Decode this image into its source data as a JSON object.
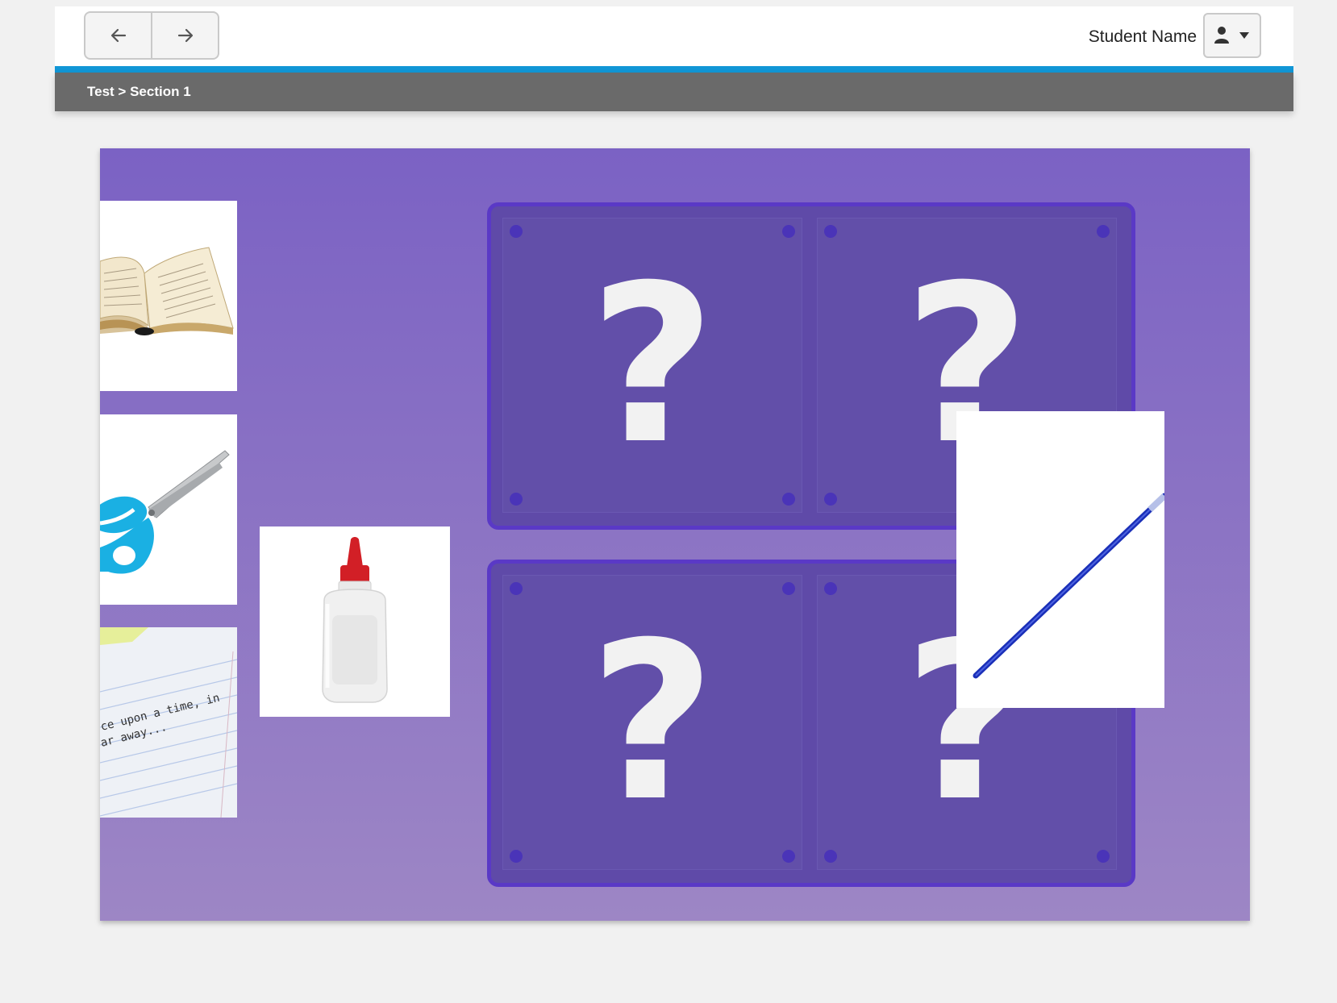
{
  "header": {
    "back_label": "Back",
    "forward_label": "Forward",
    "student_name": "Student Name"
  },
  "breadcrumb": "Test > Section 1",
  "stage": {
    "drop_slots": [
      {
        "symbol": "?"
      },
      {
        "symbol": "?"
      },
      {
        "symbol": "?"
      },
      {
        "symbol": "?"
      }
    ],
    "cards": [
      {
        "item": "open-book"
      },
      {
        "item": "scissors"
      },
      {
        "item": "notebook-page",
        "text_line1": "ce upon a time, in",
        "text_line2": "ar away..."
      },
      {
        "item": "glue-bottle"
      },
      {
        "item": "blue-pen"
      }
    ]
  },
  "colors": {
    "accent": "#1196d6",
    "stage_top": "#7b62c4",
    "stage_bottom": "#9d86c5",
    "board_border": "#5a39c6"
  }
}
